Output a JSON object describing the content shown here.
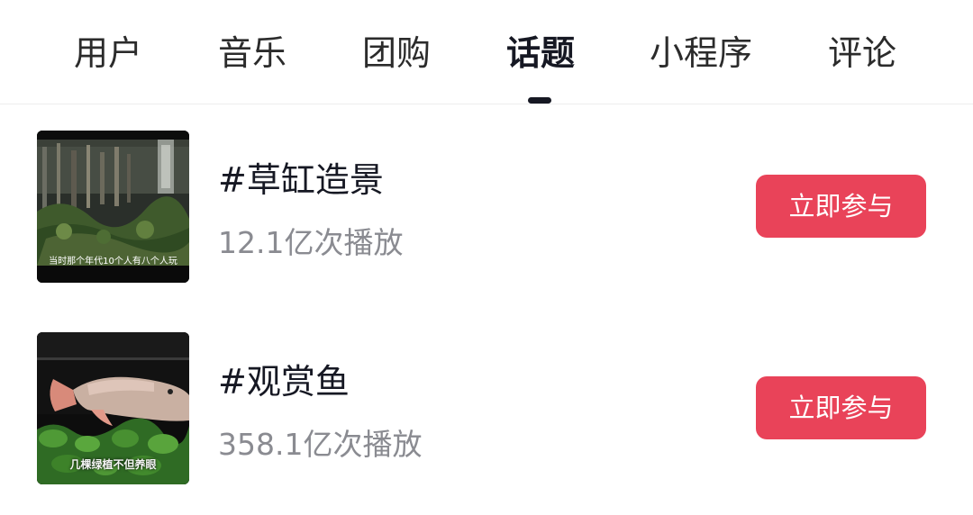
{
  "tabs": [
    {
      "label": "用户"
    },
    {
      "label": "音乐"
    },
    {
      "label": "团购"
    },
    {
      "label": "话题",
      "active": true
    },
    {
      "label": "小程序"
    },
    {
      "label": "评论"
    }
  ],
  "topics": [
    {
      "title": "#草缸造景",
      "plays": "12.1亿次播放",
      "thumbnail_caption": "当时那个年代10个人有八个人玩",
      "button_label": "立即参与"
    },
    {
      "title": "#观赏鱼",
      "plays": "358.1亿次播放",
      "thumbnail_caption": "几棵绿植不但养眼",
      "button_label": "立即参与"
    }
  ],
  "colors": {
    "accent": "#e94359",
    "text_primary": "#161823",
    "text_secondary": "#8a8b91"
  }
}
